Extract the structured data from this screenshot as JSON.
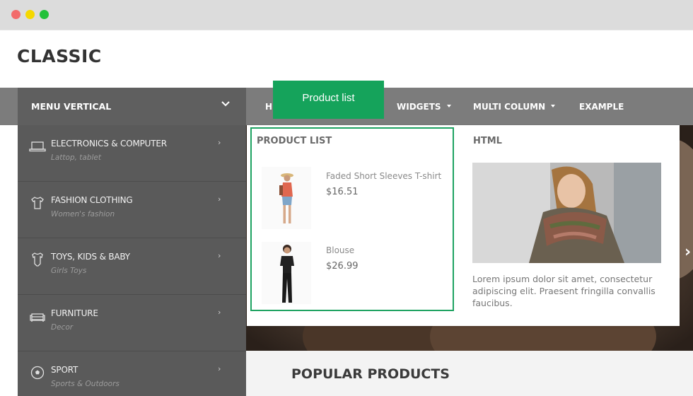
{
  "window": {
    "controls": [
      "close",
      "minimize",
      "maximize"
    ]
  },
  "header": {
    "logo": "CLASSIC"
  },
  "menu_vertical": {
    "title": "MENU VERTICAL",
    "toggle_icon": "chevron-down-icon",
    "items": [
      {
        "label": "ELECTRONICS & COMPUTER",
        "sub": "Lattop, tablet",
        "icon": "laptop-icon"
      },
      {
        "label": "FASHION CLOTHING",
        "sub": "Women's fashion",
        "icon": "shirt-icon"
      },
      {
        "label": "TOYS, KIDS & BABY",
        "sub": "Girls Toys",
        "icon": "baby-onesie-icon"
      },
      {
        "label": "FURNITURE",
        "sub": "Decor",
        "icon": "sofa-icon"
      },
      {
        "label": "SPORT",
        "sub": "Sports & Outdoors",
        "icon": "soccer-ball-icon"
      }
    ],
    "arrow": "›"
  },
  "nav": {
    "home_partial": "H",
    "items": [
      {
        "label": "WIDGETS",
        "has_caret": true
      },
      {
        "label": "MULTI COLUMN",
        "has_caret": true
      },
      {
        "label": "EXAMPLE",
        "has_caret": false
      }
    ]
  },
  "tooltip": {
    "label": "Product list",
    "color": "#15a35b"
  },
  "dropdown": {
    "product_list": {
      "title": "PRODUCT LIST",
      "products": [
        {
          "name": "Faded Short Sleeves T-shirt",
          "price": "$16.51"
        },
        {
          "name": "Blouse",
          "price": "$26.99"
        }
      ]
    },
    "html_block": {
      "title": "HTML",
      "text": "Lorem ipsum dolor sit amet, consectetur adipiscing elit. Praesent fringilla convallis faucibus."
    }
  },
  "hero": {
    "next_arrow": "›"
  },
  "main": {
    "section_title": "POPULAR PRODUCTS"
  }
}
